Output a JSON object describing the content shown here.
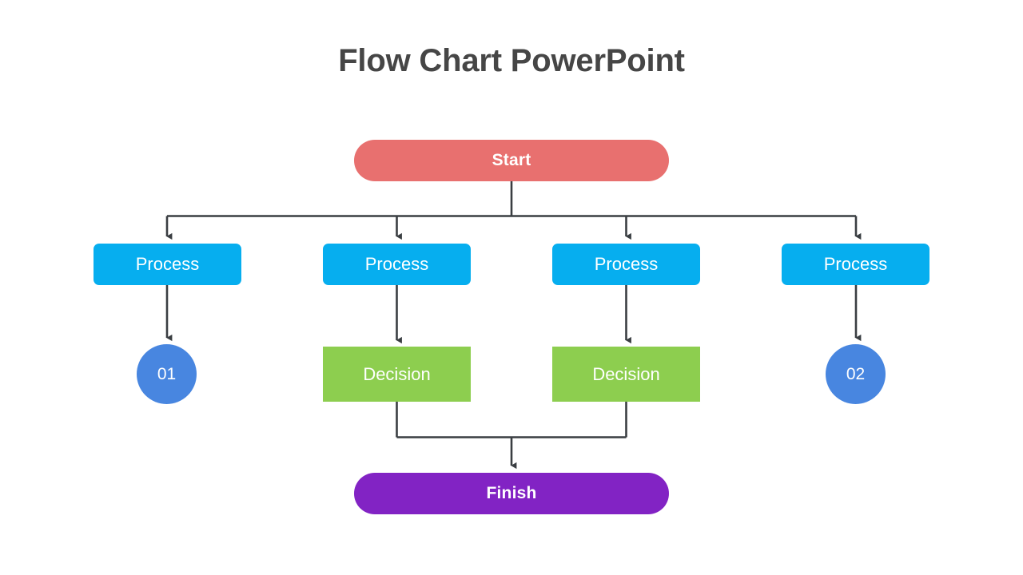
{
  "slide": {
    "title": "Flow Chart PowerPoint",
    "background_color": "#FFFFFF",
    "title_color": "#464646"
  },
  "palette": {
    "start": "#E8706F",
    "process": "#06AEEF",
    "decision": "#8DCE4F",
    "circle": "#4886E0",
    "finish": "#8223C4",
    "connector": "#3A3E42",
    "node_text": "#FFFFFF"
  },
  "chart_data": {
    "type": "diagram",
    "diagram_kind": "flowchart",
    "title": "Flow Chart PowerPoint",
    "orientation": "top-to-bottom",
    "nodes": [
      {
        "id": "start",
        "label": "Start",
        "shape": "pill",
        "color": "#E8706F",
        "row": 1,
        "column": "center"
      },
      {
        "id": "process-1",
        "label": "Process",
        "shape": "rounded-rect",
        "color": "#06AEEF",
        "row": 2,
        "column": 1
      },
      {
        "id": "process-2",
        "label": "Process",
        "shape": "rounded-rect",
        "color": "#06AEEF",
        "row": 2,
        "column": 2
      },
      {
        "id": "process-3",
        "label": "Process",
        "shape": "rounded-rect",
        "color": "#06AEEF",
        "row": 2,
        "column": 3
      },
      {
        "id": "process-4",
        "label": "Process",
        "shape": "rounded-rect",
        "color": "#06AEEF",
        "row": 2,
        "column": 4
      },
      {
        "id": "count-01",
        "label": "01",
        "shape": "circle",
        "color": "#4886E0",
        "row": 3,
        "column": 1
      },
      {
        "id": "decision-1",
        "label": "Decision",
        "shape": "rect",
        "color": "#8DCE4F",
        "row": 3,
        "column": 2
      },
      {
        "id": "decision-2",
        "label": "Decision",
        "shape": "rect",
        "color": "#8DCE4F",
        "row": 3,
        "column": 3
      },
      {
        "id": "count-02",
        "label": "02",
        "shape": "circle",
        "color": "#4886E0",
        "row": 3,
        "column": 4
      },
      {
        "id": "finish",
        "label": "Finish",
        "shape": "pill",
        "color": "#8223C4",
        "row": 4,
        "column": "center"
      }
    ],
    "edges": [
      {
        "from": "start",
        "to": "process-1",
        "arrow": true,
        "style": "orthogonal"
      },
      {
        "from": "start",
        "to": "process-2",
        "arrow": true,
        "style": "orthogonal"
      },
      {
        "from": "start",
        "to": "process-3",
        "arrow": true,
        "style": "orthogonal"
      },
      {
        "from": "start",
        "to": "process-4",
        "arrow": true,
        "style": "orthogonal"
      },
      {
        "from": "process-1",
        "to": "count-01",
        "arrow": true,
        "style": "straight"
      },
      {
        "from": "process-2",
        "to": "decision-1",
        "arrow": true,
        "style": "straight"
      },
      {
        "from": "process-3",
        "to": "decision-2",
        "arrow": true,
        "style": "straight"
      },
      {
        "from": "process-4",
        "to": "count-02",
        "arrow": true,
        "style": "straight"
      },
      {
        "from": "decision-1",
        "to": "finish",
        "arrow": true,
        "style": "orthogonal"
      },
      {
        "from": "decision-2",
        "to": "finish",
        "arrow": true,
        "style": "orthogonal"
      }
    ]
  },
  "nodes": {
    "start": {
      "label": "Start"
    },
    "process_1": {
      "label": "Process"
    },
    "process_2": {
      "label": "Process"
    },
    "process_3": {
      "label": "Process"
    },
    "process_4": {
      "label": "Process"
    },
    "count_01": {
      "label": "01"
    },
    "decision_1": {
      "label": "Decision"
    },
    "decision_2": {
      "label": "Decision"
    },
    "count_02": {
      "label": "02"
    },
    "finish": {
      "label": "Finish"
    }
  }
}
